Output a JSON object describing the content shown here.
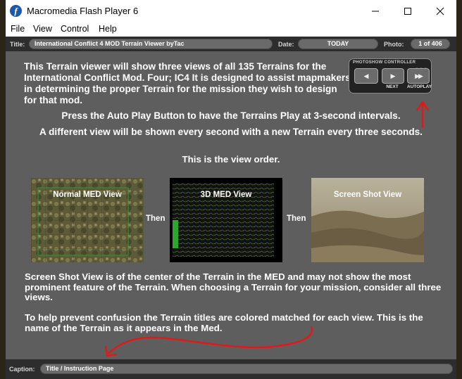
{
  "window": {
    "title": "Macromedia Flash Player 6"
  },
  "menu": {
    "file": "File",
    "view": "View",
    "control": "Control",
    "help": "Help"
  },
  "toolbar": {
    "title_label": "Title:",
    "title_value": "International Conflict 4 MOD Terrain Viewer byTac",
    "date_label": "Date:",
    "date_value": "TODAY",
    "photo_label": "Photo:",
    "photo_value": "1 of 406"
  },
  "controller": {
    "title": "PHOTOSHOW CONTROLLER",
    "next_label": "NEXT",
    "autoplay_label": "AUTOPLAY"
  },
  "slide": {
    "intro": "This Terrain viewer will show three views of all 135 Terrains for the International Conflict Mod. Four; IC4 It is designed to assist mapmakers in determining the proper Terrain for the mission they wish to design for that mod.",
    "autoplay_note": "Press the Auto Play Button to have the Terrains Play at 3-second intervals.",
    "interval_note": "A different view will be shown every second with a new Terrain every three seconds.",
    "order_heading": "This is the view order.",
    "views": [
      {
        "caption": "Normal MED View"
      },
      {
        "caption": "3D MED View"
      },
      {
        "caption": "Screen Shot View"
      }
    ],
    "then_1": "Then",
    "then_2": "Then",
    "screenshot_note": "Screen Shot View is of the center of the Terrain in the MED and may not show the most prominent feature of the Terrain. When choosing a Terrain for your mission, consider all three views.",
    "titles_note": "To help prevent confusion the Terrain titles are colored matched for each view. This is the name of the Terrain as it appears in the Med."
  },
  "caption": {
    "label": "Caption:",
    "value": "Title / Instruction Page"
  },
  "colors": {
    "background": "#5e5e5e",
    "bars": "#2d2d2d",
    "pill": "#6a6a6a",
    "annotation": "#e0191b"
  }
}
